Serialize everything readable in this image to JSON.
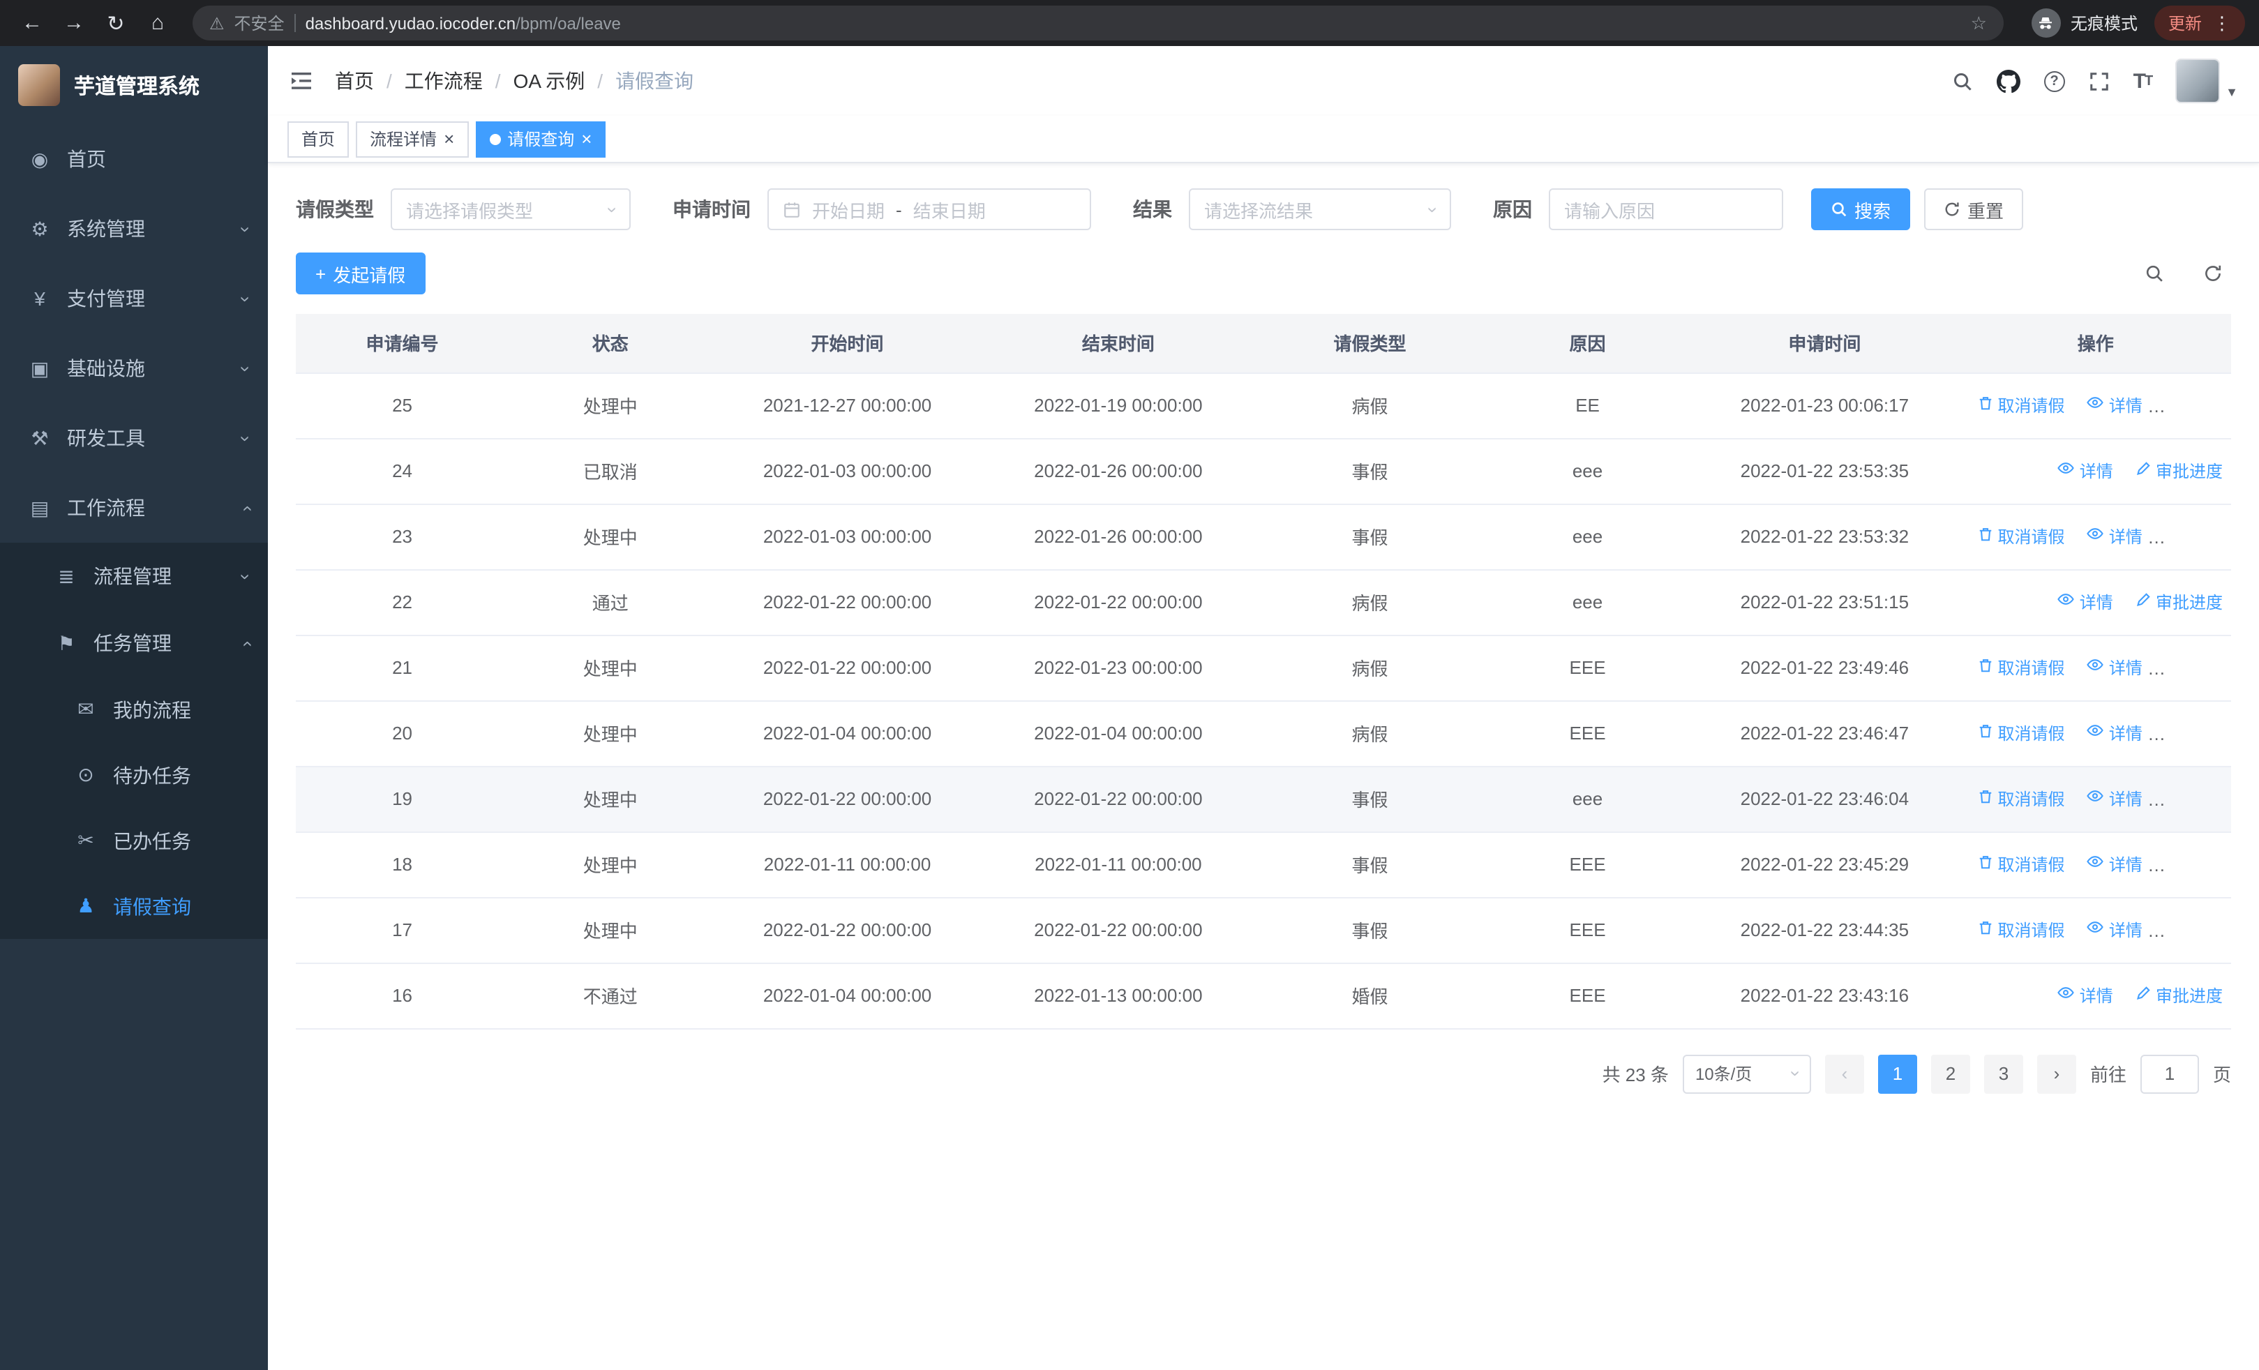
{
  "browser": {
    "security_warning": "不安全",
    "url_domain": "dashboard.yudao.iocoder.cn",
    "url_path": "/bpm/oa/leave",
    "incognito_label": "无痕模式",
    "update_label": "更新"
  },
  "sidebar": {
    "app_title": "芋道管理系统",
    "items": [
      {
        "label": "首页",
        "icon": "home-dashboard-icon",
        "level": 1,
        "chevron": null,
        "sub": false,
        "active": false
      },
      {
        "label": "系统管理",
        "icon": "gear-icon",
        "level": 1,
        "chevron": "down",
        "sub": false,
        "active": false
      },
      {
        "label": "支付管理",
        "icon": "yen-icon",
        "level": 1,
        "chevron": "down",
        "sub": false,
        "active": false
      },
      {
        "label": "基础设施",
        "icon": "monitor-icon",
        "level": 1,
        "chevron": "down",
        "sub": false,
        "active": false
      },
      {
        "label": "研发工具",
        "icon": "tools-icon",
        "level": 1,
        "chevron": "down",
        "sub": false,
        "active": false
      },
      {
        "label": "工作流程",
        "icon": "workflow-icon",
        "level": 1,
        "chevron": "up",
        "sub": false,
        "active": false
      },
      {
        "label": "流程管理",
        "icon": "process-icon",
        "level": 2,
        "chevron": "down",
        "sub": true,
        "active": false
      },
      {
        "label": "任务管理",
        "icon": "task-icon",
        "level": 2,
        "chevron": "up",
        "sub": true,
        "active": false
      },
      {
        "label": "我的流程",
        "icon": "my-process-icon",
        "level": 3,
        "chevron": null,
        "sub": true,
        "active": false
      },
      {
        "label": "待办任务",
        "icon": "todo-eye-icon",
        "level": 3,
        "chevron": null,
        "sub": true,
        "active": false
      },
      {
        "label": "已办任务",
        "icon": "done-task-icon",
        "level": 3,
        "chevron": null,
        "sub": true,
        "active": false
      },
      {
        "label": "请假查询",
        "icon": "leave-query-user-icon",
        "level": 3,
        "chevron": null,
        "sub": true,
        "active": true
      }
    ]
  },
  "header": {
    "breadcrumb": [
      "首页",
      "工作流程",
      "OA 示例",
      "请假查询"
    ]
  },
  "tabs": [
    {
      "label": "首页"
    },
    {
      "label": "流程详情"
    },
    {
      "label": "请假查询"
    }
  ],
  "filters": {
    "leave_type_label": "请假类型",
    "leave_type_placeholder": "请选择请假类型",
    "apply_time_label": "申请时间",
    "start_date_placeholder": "开始日期",
    "range_separator": "-",
    "end_date_placeholder": "结束日期",
    "result_label": "结果",
    "result_placeholder": "请选择流结果",
    "reason_label": "原因",
    "reason_placeholder": "请输入原因",
    "search_label": "搜索",
    "reset_label": "重置"
  },
  "toolbar": {
    "create_label": "发起请假"
  },
  "table": {
    "columns": [
      "申请编号",
      "状态",
      "开始时间",
      "结束时间",
      "请假类型",
      "原因",
      "申请时间",
      "操作"
    ],
    "actions": {
      "cancel": "取消请假",
      "detail": "详情",
      "progress": "审批进度"
    },
    "rows": [
      {
        "id": "25",
        "status": "处理中",
        "start": "2021-12-27 00:00:00",
        "end": "2022-01-19 00:00:00",
        "type": "病假",
        "reason": "EE",
        "applied": "2022-01-23 00:06:17",
        "cancelable": true,
        "highlighted": false
      },
      {
        "id": "24",
        "status": "已取消",
        "start": "2022-01-03 00:00:00",
        "end": "2022-01-26 00:00:00",
        "type": "事假",
        "reason": "eee",
        "applied": "2022-01-22 23:53:35",
        "cancelable": false,
        "highlighted": false
      },
      {
        "id": "23",
        "status": "处理中",
        "start": "2022-01-03 00:00:00",
        "end": "2022-01-26 00:00:00",
        "type": "事假",
        "reason": "eee",
        "applied": "2022-01-22 23:53:32",
        "cancelable": true,
        "highlighted": false
      },
      {
        "id": "22",
        "status": "通过",
        "start": "2022-01-22 00:00:00",
        "end": "2022-01-22 00:00:00",
        "type": "病假",
        "reason": "eee",
        "applied": "2022-01-22 23:51:15",
        "cancelable": false,
        "highlighted": false
      },
      {
        "id": "21",
        "status": "处理中",
        "start": "2022-01-22 00:00:00",
        "end": "2022-01-23 00:00:00",
        "type": "病假",
        "reason": "EEE",
        "applied": "2022-01-22 23:49:46",
        "cancelable": true,
        "highlighted": false
      },
      {
        "id": "20",
        "status": "处理中",
        "start": "2022-01-04 00:00:00",
        "end": "2022-01-04 00:00:00",
        "type": "病假",
        "reason": "EEE",
        "applied": "2022-01-22 23:46:47",
        "cancelable": true,
        "highlighted": false
      },
      {
        "id": "19",
        "status": "处理中",
        "start": "2022-01-22 00:00:00",
        "end": "2022-01-22 00:00:00",
        "type": "事假",
        "reason": "eee",
        "applied": "2022-01-22 23:46:04",
        "cancelable": true,
        "highlighted": true
      },
      {
        "id": "18",
        "status": "处理中",
        "start": "2022-01-11 00:00:00",
        "end": "2022-01-11 00:00:00",
        "type": "事假",
        "reason": "EEE",
        "applied": "2022-01-22 23:45:29",
        "cancelable": true,
        "highlighted": false
      },
      {
        "id": "17",
        "status": "处理中",
        "start": "2022-01-22 00:00:00",
        "end": "2022-01-22 00:00:00",
        "type": "事假",
        "reason": "EEE",
        "applied": "2022-01-22 23:44:35",
        "cancelable": true,
        "highlighted": false
      },
      {
        "id": "16",
        "status": "不通过",
        "start": "2022-01-04 00:00:00",
        "end": "2022-01-13 00:00:00",
        "type": "婚假",
        "reason": "EEE",
        "applied": "2022-01-22 23:43:16",
        "cancelable": false,
        "highlighted": false
      }
    ]
  },
  "pagination": {
    "total": "共 23 条",
    "page_size": "10条/页",
    "pages": [
      "1",
      "2",
      "3"
    ],
    "active_page": "1",
    "goto_label": "前往",
    "goto_value": "1",
    "page_unit": "页"
  }
}
